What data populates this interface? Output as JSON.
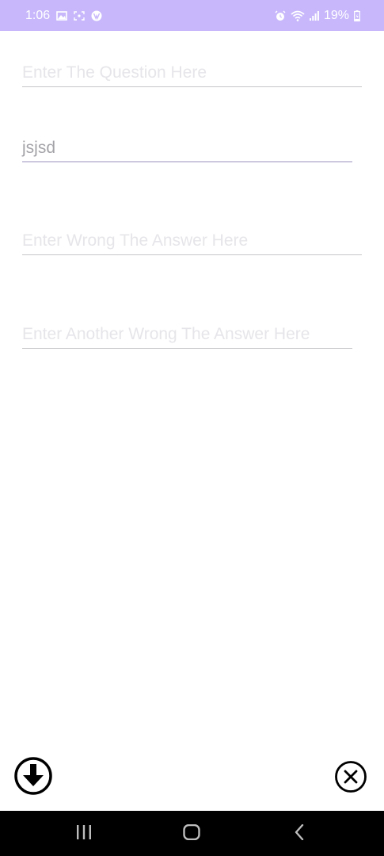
{
  "status_bar": {
    "time": "1:06",
    "battery": "19%",
    "background_color": "#c8b8fb",
    "left_icons": [
      "gallery-icon",
      "screenshot-icon",
      "vpn-icon"
    ],
    "right_icons": [
      "alarm-icon",
      "wifi-icon",
      "signal-icon",
      "battery-icon"
    ]
  },
  "form": {
    "question": {
      "placeholder": "Enter The Question Here",
      "value": ""
    },
    "answer": {
      "placeholder": "",
      "value": "jsjsd"
    },
    "wrong_answer": {
      "placeholder": "Enter Wrong The Answer Here",
      "value": ""
    },
    "another_wrong_answer": {
      "placeholder": "Enter Another Wrong The Answer Here",
      "value": ""
    }
  },
  "actions": {
    "download_icon": "download-icon",
    "close_icon": "close-icon"
  },
  "nav_bar": {
    "background_color": "#000000",
    "buttons": [
      "recents-icon",
      "home-icon",
      "back-icon"
    ]
  }
}
